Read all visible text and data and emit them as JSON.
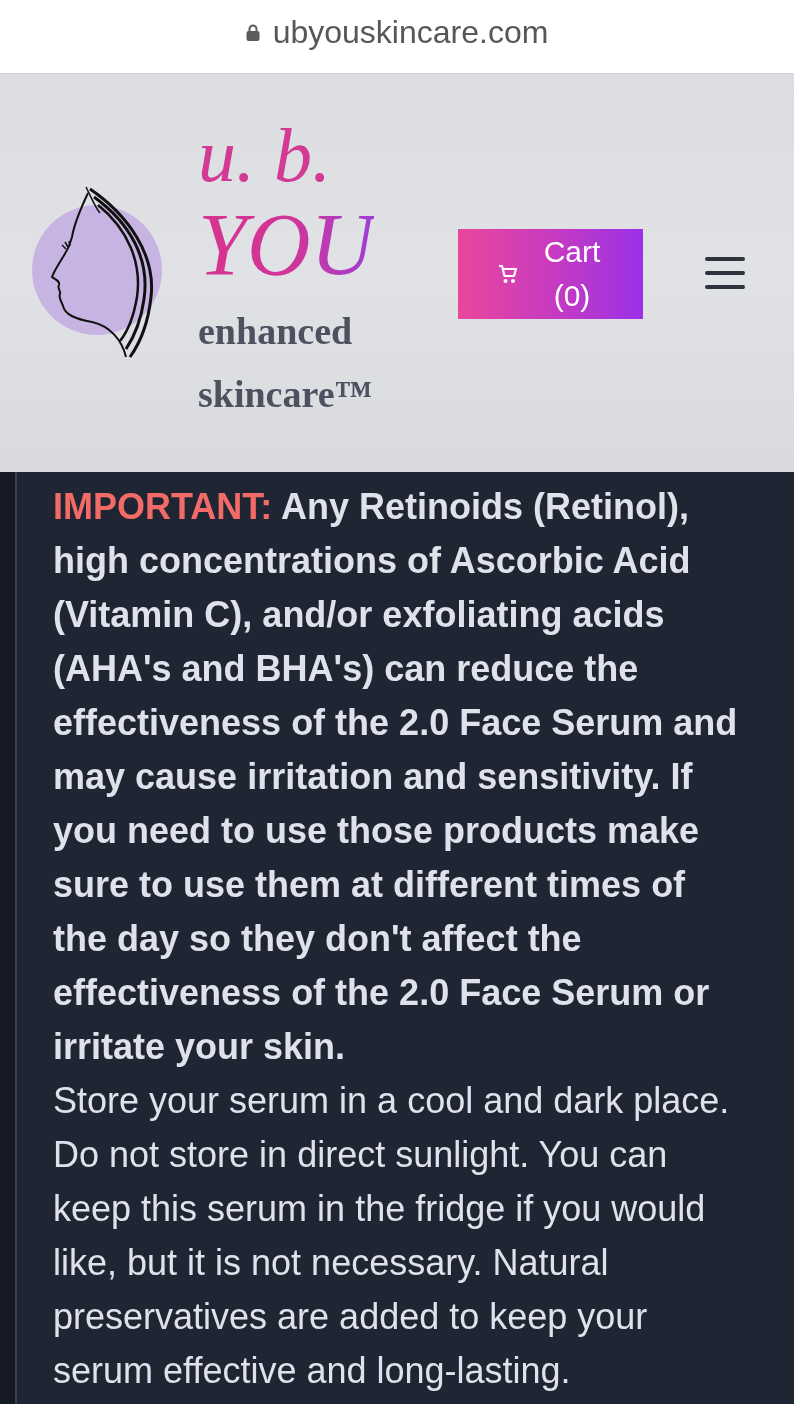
{
  "browser": {
    "url": "ubyouskincare.com"
  },
  "header": {
    "logo": {
      "initials": "u. b.",
      "wordmark": "YOU",
      "tagline": [
        "enhanced",
        "skincare™"
      ]
    },
    "cart_button": {
      "label": "Cart (0)"
    }
  },
  "content": {
    "warning": {
      "label": "IMPORTANT:",
      "text": "Any Retinoids (Retinol), high concentrations of Ascorbic Acid (Vitamin C), and/or exfoliating acids (AHA's and BHA's) can reduce the effectiveness of the 2.0 Face Serum and may cause irritation and sensitivity. If you need to use those products make sure to use them at different times of the day so they don't affect the effectiveness of the 2.0 Face Serum or irritate your skin."
    },
    "paragraphs": [
      "Store your serum in a cool and dark place. Do not store in direct sunlight. You can keep this serum in the fridge if you would like, but it is not necessary. Natural preservatives are added to keep your serum effective and long-lasting."
    ]
  }
}
